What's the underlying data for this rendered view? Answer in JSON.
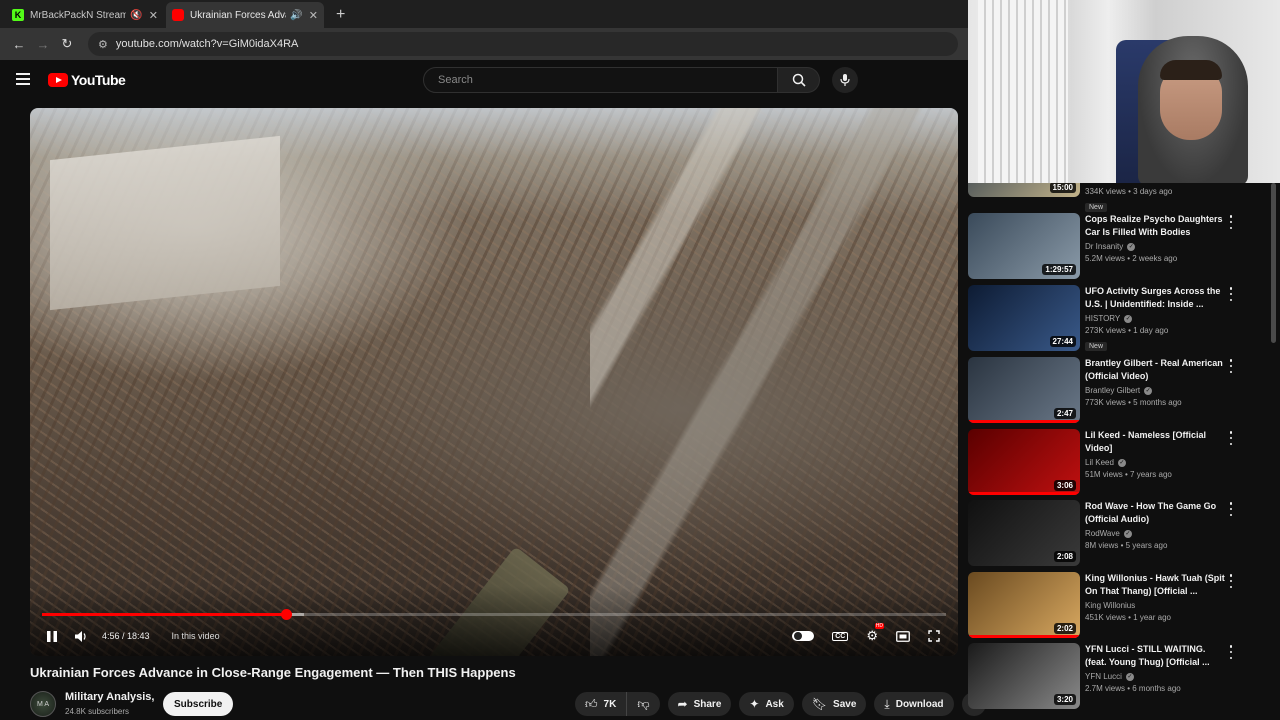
{
  "browser": {
    "tabs": [
      {
        "title": "MrBackPackN Stream - Watc",
        "favicon_color": "#53fc18",
        "favicon_glyph": "K",
        "active": false
      },
      {
        "title": "Ukrainian Forces Advance in",
        "favicon_color": "#ff0000",
        "favicon_glyph": "",
        "active": true
      }
    ],
    "new_tab_label": "+",
    "url": "youtube.com/watch?v=GiM0idaX4RA"
  },
  "header": {
    "logo_text": "YouTube",
    "search_placeholder": "Search"
  },
  "player": {
    "time": "4:56 / 18:43",
    "in_this_video": "In this video",
    "progress_played_fraction": 0.27,
    "progress_loaded_fraction": 0.29
  },
  "video": {
    "title": "Ukrainian Forces Advance in Close-Range Engagement — Then THIS Happens",
    "channel": "Military Analysis,",
    "channel_avatar_text": "M A",
    "subscribers": "24.8K subscribers",
    "subscribe_label": "Subscribe",
    "likes": "7K",
    "share_label": "Share",
    "ask_label": "Ask",
    "save_label": "Save",
    "download_label": "Download"
  },
  "sidebar": {
    "partial_top": {
      "meta": "334K views • 3 days ago",
      "badge": "New",
      "duration": "15:00"
    },
    "items": [
      {
        "title": "Cops Realize Psycho Daughters Car Is Filled With Bodies",
        "channel": "Dr Insanity",
        "verified": true,
        "meta": "5.2M views • 2 weeks ago",
        "duration": "1:29:57",
        "badge": "",
        "watched": 0,
        "thumb_colors": [
          "#3a4a5a",
          "#8a9aa8"
        ]
      },
      {
        "title": "UFO Activity Surges Across the U.S. | Unidentified: Inside ...",
        "channel": "HISTORY",
        "verified": true,
        "meta": "273K views • 1 day ago",
        "duration": "27:44",
        "badge": "New",
        "watched": 0,
        "thumb_colors": [
          "#0d1b33",
          "#3a5a8a"
        ]
      },
      {
        "title": "Brantley Gilbert - Real American (Official Video)",
        "channel": "Brantley Gilbert",
        "verified": true,
        "meta": "773K views • 5 months ago",
        "duration": "2:47",
        "badge": "",
        "watched": 1,
        "thumb_colors": [
          "#2a3440",
          "#6a7888"
        ]
      },
      {
        "title": "Lil Keed - Nameless [Official Video]",
        "channel": "Lil Keed",
        "verified": true,
        "meta": "51M views • 7 years ago",
        "duration": "3:06",
        "badge": "",
        "watched": 1,
        "thumb_colors": [
          "#5a0000",
          "#c01010"
        ]
      },
      {
        "title": "Rod Wave - How The Game Go (Official Audio)",
        "channel": "RodWave",
        "verified": true,
        "meta": "8M views • 5 years ago",
        "duration": "2:08",
        "badge": "",
        "watched": 0,
        "thumb_colors": [
          "#101010",
          "#3a3a3a"
        ]
      },
      {
        "title": "King Willonius - Hawk Tuah (Spit On That Thang) [Official ...",
        "channel": "King Willonius",
        "verified": false,
        "meta": "451K views • 1 year ago",
        "duration": "2:02",
        "badge": "",
        "watched": 1,
        "thumb_colors": [
          "#6a4a20",
          "#d8a860"
        ]
      },
      {
        "title": "YFN Lucci - STILL WAITING. (feat. Young Thug) [Official ...",
        "channel": "YFN Lucci",
        "verified": true,
        "meta": "2.7M views • 6 months ago",
        "duration": "3:20",
        "badge": "",
        "watched": 0,
        "thumb_colors": [
          "#1a1a1a",
          "#8a8a8a"
        ]
      }
    ]
  },
  "colors": {
    "accent": "#ff0000",
    "bg": "#0f0f0f"
  },
  "icons": [
    "back-icon",
    "forward-icon",
    "reload-icon",
    "site-info-icon",
    "menu-icon",
    "search-icon",
    "mic-icon",
    "pause-icon",
    "volume-icon",
    "autoplay-toggle-icon",
    "captions-icon",
    "settings-icon",
    "miniplayer-icon",
    "fullscreen-icon",
    "like-icon",
    "dislike-icon",
    "share-icon",
    "ask-icon",
    "save-icon",
    "download-icon",
    "more-icon"
  ]
}
